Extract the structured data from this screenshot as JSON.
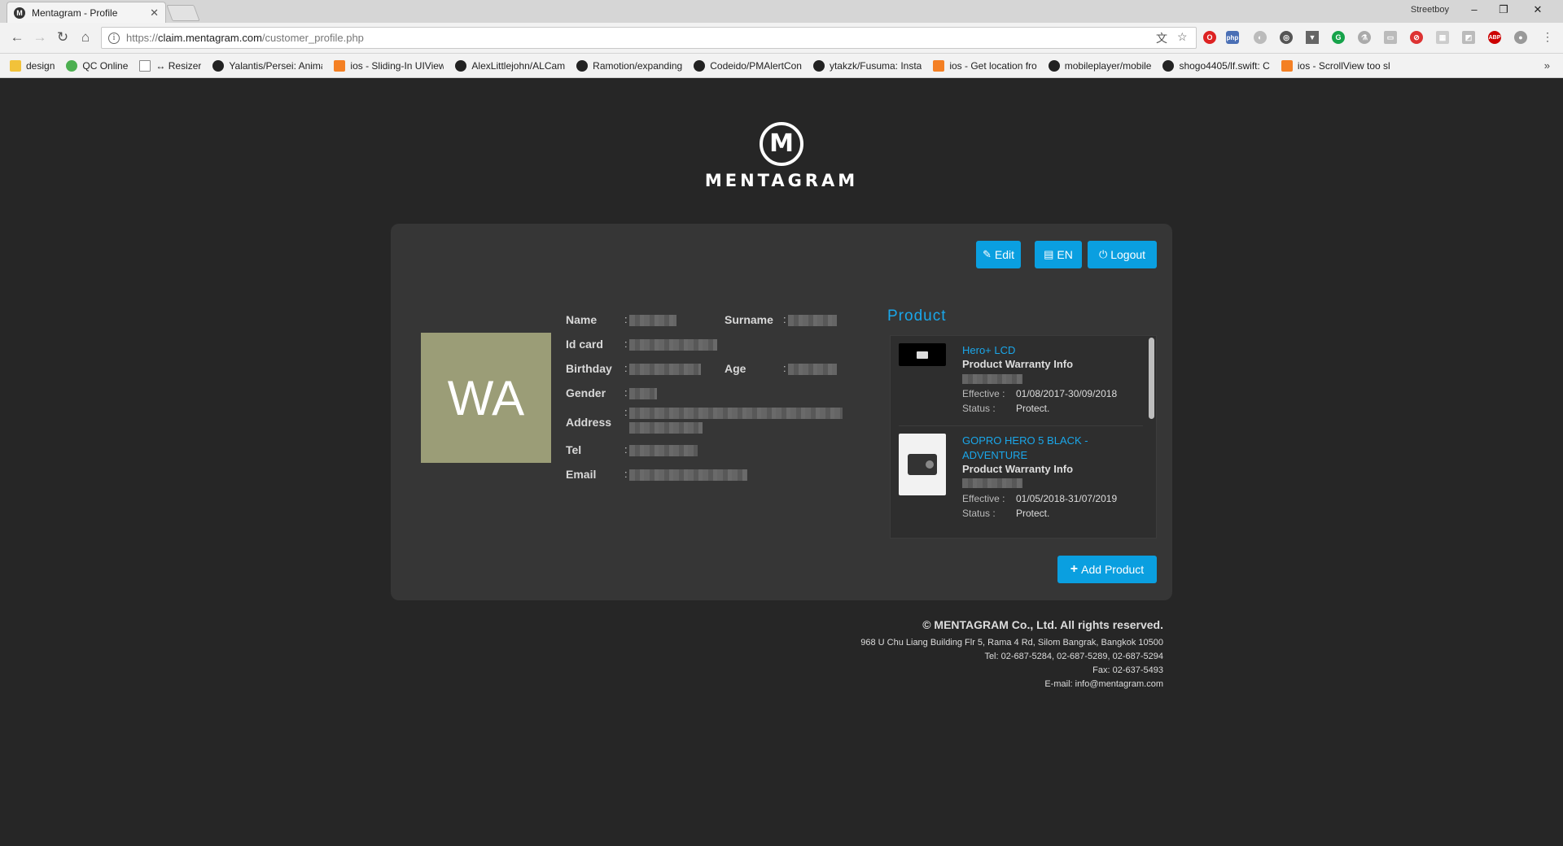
{
  "browser": {
    "tab_title": "Mentagram - Profile",
    "profile_name": "Streetboy",
    "url_scheme": "https://",
    "url_host": "claim.mentagram.com",
    "url_path": "/customer_profile.php",
    "bookmarks": [
      {
        "label": "design",
        "icon": "folder-icon"
      },
      {
        "label": "QC Online",
        "icon": "check-icon"
      },
      {
        "label": "↔ Resizer",
        "icon": "page-icon"
      },
      {
        "label": "Yalantis/Persei: Anima",
        "icon": "github-icon"
      },
      {
        "label": "ios - Sliding-In UIView",
        "icon": "stackoverflow-icon"
      },
      {
        "label": "AlexLittlejohn/ALCam",
        "icon": "github-icon"
      },
      {
        "label": "Ramotion/expanding",
        "icon": "github-icon"
      },
      {
        "label": "Codeido/PMAlertCon",
        "icon": "github-icon"
      },
      {
        "label": "ytakzk/Fusuma: Insta",
        "icon": "github-icon"
      },
      {
        "label": "ios - Get location fro",
        "icon": "stackoverflow-icon"
      },
      {
        "label": "mobileplayer/mobile",
        "icon": "github-icon"
      },
      {
        "label": "shogo4405/lf.swift: C",
        "icon": "github-icon"
      },
      {
        "label": "ios - ScrollView too sl",
        "icon": "stackoverflow-icon"
      }
    ],
    "more_bookmarks": "»"
  },
  "logo": {
    "wordmark": "MENTAGRAM",
    "mark": "M"
  },
  "actions": {
    "edit": "Edit",
    "language": "EN",
    "logout": "Logout",
    "add_product": "Add Product"
  },
  "profile": {
    "initials": "WA",
    "labels": {
      "name": "Name",
      "surname": "Surname",
      "id_card": "Id card",
      "birthday": "Birthday",
      "age": "Age",
      "gender": "Gender",
      "address": "Address",
      "tel": "Tel",
      "email": "Email"
    },
    "colon": ":"
  },
  "products": {
    "heading": "Product",
    "items": [
      {
        "name": "Hero+ LCD",
        "subtitle": "Product Warranty Info",
        "effective_label": "Effective :",
        "effective": "01/08/2017-30/09/2018",
        "status_label": "Status :",
        "status": "Protect."
      },
      {
        "name": "GOPRO HERO 5 BLACK - ADVENTURE",
        "subtitle": "Product Warranty Info",
        "effective_label": "Effective :",
        "effective": "01/05/2018-31/07/2019",
        "status_label": "Status :",
        "status": "Protect."
      }
    ]
  },
  "footer": {
    "copyright": "© MENTAGRAM Co., Ltd. All rights reserved.",
    "address": "968 U Chu Liang Building Flr 5, Rama 4 Rd, Silom Bangrak, Bangkok 10500",
    "tel": "Tel: 02-687-5284, 02-687-5289, 02-687-5294",
    "fax": "Fax: 02-637-5493",
    "email": "E-mail: info@mentagram.com"
  }
}
